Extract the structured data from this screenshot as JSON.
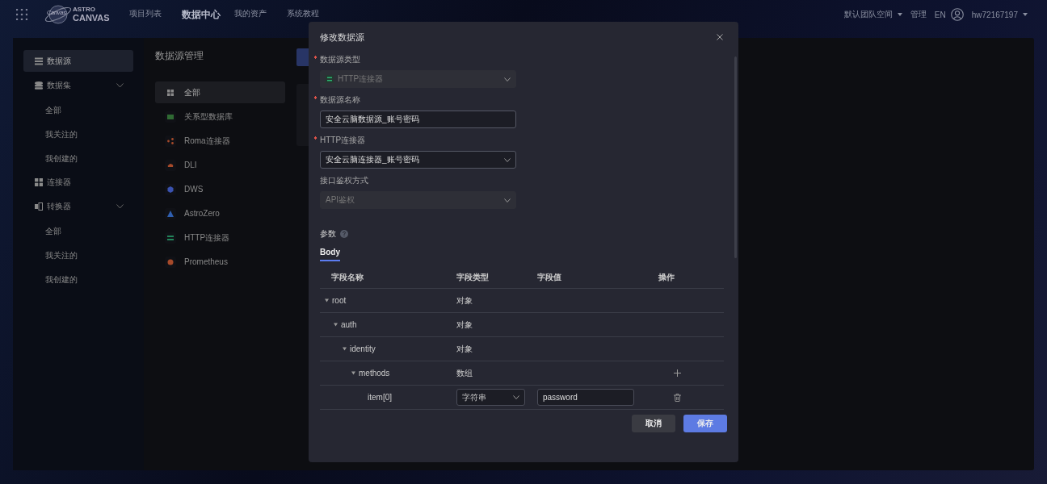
{
  "topbar": {
    "logo_small": "Canvas",
    "logo_line1": "ASTRO",
    "logo_line2": "CANVAS",
    "nav": [
      {
        "label": "项目列表",
        "selected": false
      },
      {
        "label": "数据中心",
        "selected": true
      },
      {
        "label": "我的资产",
        "selected": false
      },
      {
        "label": "系统教程",
        "selected": false
      }
    ],
    "team": "默认团队空间",
    "manage": "管理",
    "lang": "EN",
    "user": "hw72167197"
  },
  "sidebar": {
    "items": [
      {
        "label": "数据源",
        "selected": true
      },
      {
        "label": "数据集",
        "selected": false,
        "expanded": true,
        "children": [
          {
            "label": "全部"
          },
          {
            "label": "我关注的"
          },
          {
            "label": "我创建的"
          }
        ]
      },
      {
        "label": "连接器",
        "selected": false
      },
      {
        "label": "转换器",
        "selected": false,
        "expanded": true,
        "children": [
          {
            "label": "全部"
          },
          {
            "label": "我关注的"
          },
          {
            "label": "我创建的"
          }
        ]
      }
    ]
  },
  "panel": {
    "title": "数据源管理",
    "types": [
      {
        "label": "全部",
        "color": "#8a8a8a",
        "selected": true
      },
      {
        "label": "关系型数据库",
        "color": "#2f6a33",
        "selected": false
      },
      {
        "label": "Roma连接器",
        "color": "#a64a2a",
        "selected": false
      },
      {
        "label": "DLI",
        "color": "#a64a2a",
        "selected": false
      },
      {
        "label": "DWS",
        "color": "#3a52b0",
        "selected": false
      },
      {
        "label": "AstroZero",
        "color": "#2f5fb0",
        "selected": false
      },
      {
        "label": "HTTP连接器",
        "color": "#22845a",
        "selected": false
      },
      {
        "label": "Prometheus",
        "color": "#a64a2a",
        "selected": false
      }
    ]
  },
  "modal": {
    "title": "修改数据源",
    "fields": [
      {
        "label": "数据源类型",
        "required": true,
        "kind": "select",
        "value": "HTTP连接器",
        "disabled": true
      },
      {
        "label": "数据源名称",
        "required": true,
        "kind": "input",
        "value": "安全云脑数据源_账号密码",
        "disabled": false
      },
      {
        "label": "HTTP连接器",
        "required": true,
        "kind": "select",
        "value": "安全云脑连接器_账号密码",
        "disabled": false
      },
      {
        "label": "接口鉴权方式",
        "required": false,
        "kind": "select",
        "value": "API鉴权",
        "disabled": true
      }
    ],
    "params_label": "参数",
    "tabs": [
      {
        "label": "Body",
        "selected": true
      }
    ],
    "table": {
      "columns": [
        "字段名称",
        "字段类型",
        "字段值",
        "操作"
      ],
      "rows": [
        {
          "name": "root",
          "type": "对象",
          "kind": "group",
          "expanded": true,
          "children": [
            {
              "name": "auth",
              "type": "对象",
              "kind": "group",
              "expanded": true,
              "children": [
                {
                  "name": "identity",
                  "type": "对象",
                  "kind": "group",
                  "expanded": true,
                  "children": [
                    {
                      "name": "methods",
                      "type": "数组",
                      "kind": "array",
                      "expanded": true,
                      "children": [
                        {
                          "name": "item[0]",
                          "type": "字符串",
                          "kind": "value",
                          "value": "password"
                        }
                      ]
                    }
                  ]
                }
              ]
            }
          ]
        }
      ]
    },
    "buttons": [
      {
        "label": "取消",
        "kind": "secondary"
      },
      {
        "label": "保存",
        "kind": "primary"
      }
    ]
  }
}
